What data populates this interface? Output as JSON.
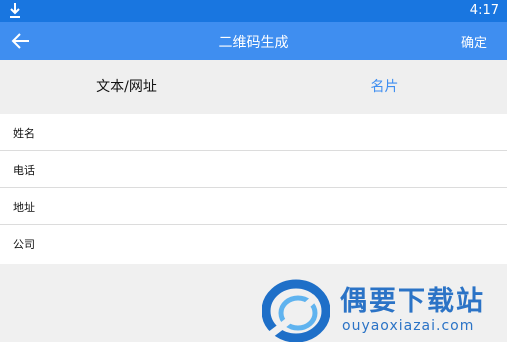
{
  "status_bar": {
    "time": "4:17",
    "download_icon": "download-icon"
  },
  "app_bar": {
    "title": "二维码生成",
    "back_icon": "arrow-left-icon",
    "confirm_label": "确定"
  },
  "tabs": [
    {
      "label": "文本/网址",
      "selected": false
    },
    {
      "label": "名片",
      "selected": true
    }
  ],
  "form": {
    "fields": [
      {
        "label": "姓名",
        "value": ""
      },
      {
        "label": "电话",
        "value": ""
      },
      {
        "label": "地址",
        "value": ""
      },
      {
        "label": "公司",
        "value": ""
      }
    ]
  },
  "watermark": {
    "text": "偶要下载站",
    "url": "ouyaoxiazai.com"
  },
  "colors": {
    "status_bar": "#1976e0",
    "app_bar": "#3f8ef0",
    "accent": "#3f8ef0",
    "watermark": "#2b73c6"
  }
}
